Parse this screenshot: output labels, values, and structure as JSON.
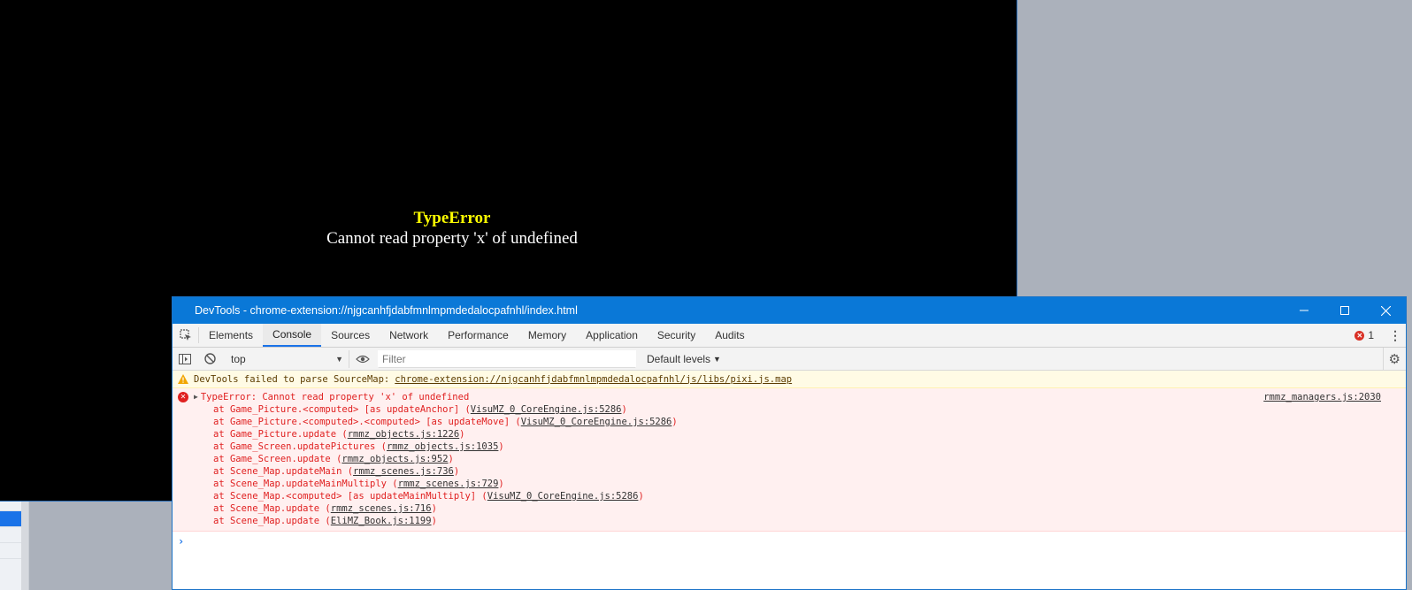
{
  "game": {
    "error_title": "TypeError",
    "error_message": "Cannot read property 'x' of undefined"
  },
  "devtools": {
    "window_title": "DevTools - chrome-extension://njgcanhfjdabfmnlmpmdedalocpafnhl/index.html",
    "tabs": [
      {
        "label": "Elements"
      },
      {
        "label": "Console",
        "active": true
      },
      {
        "label": "Sources"
      },
      {
        "label": "Network"
      },
      {
        "label": "Performance"
      },
      {
        "label": "Memory"
      },
      {
        "label": "Application"
      },
      {
        "label": "Security"
      },
      {
        "label": "Audits"
      }
    ],
    "error_count": "1",
    "toolbar": {
      "context": "top",
      "filter_placeholder": "Filter",
      "levels": "Default levels"
    },
    "warning": {
      "text": "DevTools failed to parse SourceMap:",
      "link": "chrome-extension://njgcanhfjdabfmnlmpmdedalocpafnhl/js/libs/pixi.js.map"
    },
    "error": {
      "message": "TypeError: Cannot read property 'x' of undefined",
      "source": "rmmz_managers.js:2030",
      "frames": [
        {
          "prefix": "at Game_Picture.<computed> [as updateAnchor] (",
          "link": "VisuMZ_0_CoreEngine.js:5286",
          "suffix": ")"
        },
        {
          "prefix": "at Game_Picture.<computed>.<computed> [as updateMove] (",
          "link": "VisuMZ_0_CoreEngine.js:5286",
          "suffix": ")"
        },
        {
          "prefix": "at Game_Picture.update (",
          "link": "rmmz_objects.js:1226",
          "suffix": ")"
        },
        {
          "prefix": "at Game_Screen.updatePictures (",
          "link": "rmmz_objects.js:1035",
          "suffix": ")"
        },
        {
          "prefix": "at Game_Screen.update (",
          "link": "rmmz_objects.js:952",
          "suffix": ")"
        },
        {
          "prefix": "at Scene_Map.updateMain (",
          "link": "rmmz_scenes.js:736",
          "suffix": ")"
        },
        {
          "prefix": "at Scene_Map.updateMainMultiply (",
          "link": "rmmz_scenes.js:729",
          "suffix": ")"
        },
        {
          "prefix": "at Scene_Map.<computed> [as updateMainMultiply] (",
          "link": "VisuMZ_0_CoreEngine.js:5286",
          "suffix": ")"
        },
        {
          "prefix": "at Scene_Map.update (",
          "link": "rmmz_scenes.js:716",
          "suffix": ")"
        },
        {
          "prefix": "at Scene_Map.update (",
          "link": "EliMZ_Book.js:1199",
          "suffix": ")"
        }
      ]
    },
    "prompt": "›"
  }
}
